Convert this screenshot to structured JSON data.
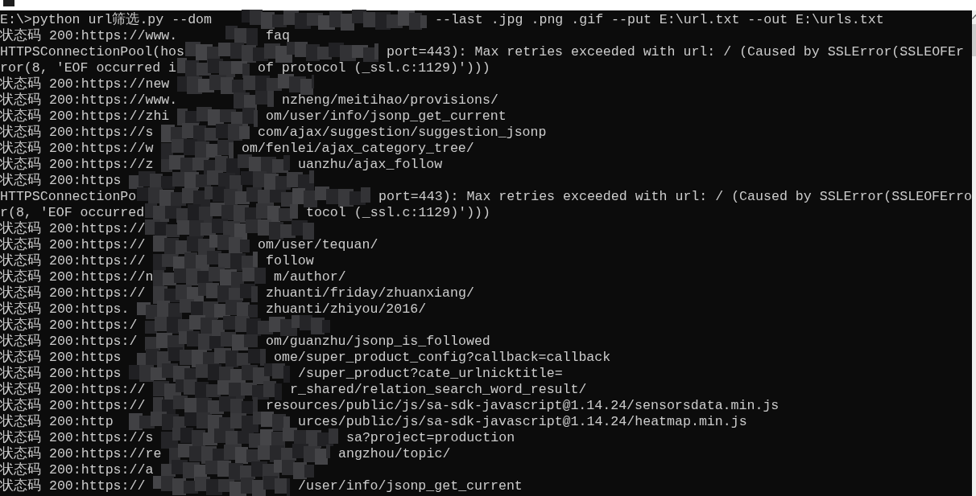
{
  "console": {
    "lines": [
      {
        "text": "E:\\>python url筛选.py --dom",
        "tail": "--last .jpg .png .gif --put E:\\url.txt --out E:\\urls.txt"
      },
      {
        "text": "状态码 200:https://www.",
        "tail": "faq"
      },
      {
        "text": "HTTPSConnectionPool(hos",
        "tail": "port=443): Max retries exceeded with url: / (Caused by SSLError(SSLEOFEr"
      },
      {
        "text": "ror(8, 'EOF occurred i",
        "tail": "of protocol (_ssl.c:1129)')))"
      },
      {
        "text": "状态码 200:https://new"
      },
      {
        "text": "状态码 200:https://www.",
        "tail": "nzheng/meitihao/provisions/"
      },
      {
        "text": "状态码 200:https://zhi",
        "tail": "om/user/info/jsonp_get_current"
      },
      {
        "text": "状态码 200:https://s",
        "tail": "com/ajax/suggestion/suggestion_jsonp"
      },
      {
        "text": "状态码 200:https://w",
        "tail": "om/fenlei/ajax_category_tree/"
      },
      {
        "text": "状态码 200:https://z",
        "tail": "uanzhu/ajax_follow"
      },
      {
        "text": "状态码 200:https"
      },
      {
        "text": "HTTPSConnectionPo",
        "tail": "port=443): Max retries exceeded with url: / (Caused by SSLError(SSLEOFErro"
      },
      {
        "text": "r(8, 'EOF occurred",
        "tail": "tocol (_ssl.c:1129)')))"
      },
      {
        "text": "状态码 200:https://"
      },
      {
        "text": "状态码 200:https://",
        "tail": "om/user/tequan/"
      },
      {
        "text": "状态码 200:https://",
        "tail": "follow"
      },
      {
        "text": "状态码 200:https://n",
        "tail": "m/author/"
      },
      {
        "text": "状态码 200:https://",
        "tail": "zhuanti/friday/zhuanxiang/"
      },
      {
        "text": "状态码 200:https.",
        "tail": "zhuanti/zhiyou/2016/"
      },
      {
        "text": "状态码 200:https:/"
      },
      {
        "text": "状态码 200:https:/",
        "tail": "om/guanzhu/jsonp_is_followed"
      },
      {
        "text": "状态码 200:https",
        "tail": "ome/super_product_config?callback=callback"
      },
      {
        "text": "状态码 200:https",
        "tail": "/super_product?cate_urlnicktitle="
      },
      {
        "text": "状态码 200:https://",
        "tail": "r_shared/relation_search_word_result/"
      },
      {
        "text": "状态码 200:https://",
        "tail": "resources/public/js/sa-sdk-javascript@1.14.24/sensorsdata.min.js"
      },
      {
        "text": "状态码 200:http",
        "tail": "urces/public/js/sa-sdk-javascript@1.14.24/heatmap.min.js"
      },
      {
        "text": "状态码 200:https://s",
        "tail": "sa?project=production"
      },
      {
        "text": "状态码 200:https://re",
        "tail": "angzhou/topic/"
      },
      {
        "text": "状态码 200:https://a"
      },
      {
        "text": "状态码 200:https://",
        "tail": "/user/info/jsonp_get_current"
      }
    ]
  }
}
